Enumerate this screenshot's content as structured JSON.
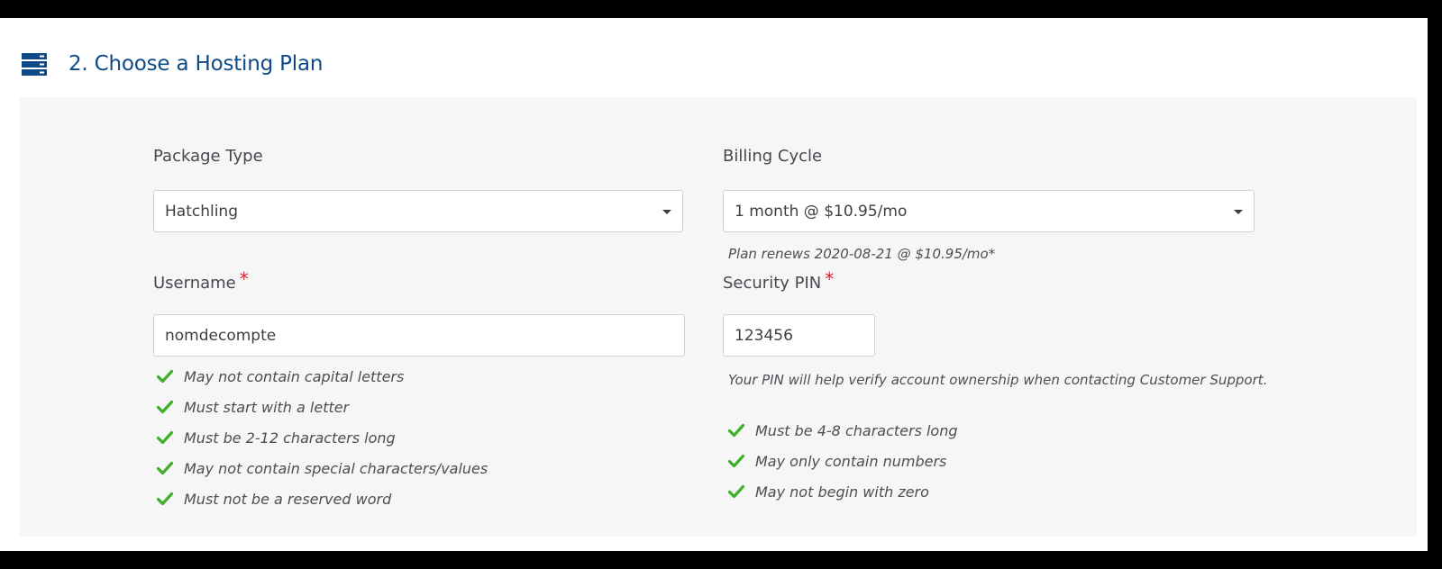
{
  "header": {
    "title": "2. Choose a Hosting Plan",
    "icon": "server-stack-icon",
    "accent_color": "#0e4a86"
  },
  "package_type": {
    "label": "Package Type",
    "selected": "Hatchling"
  },
  "billing_cycle": {
    "label": "Billing Cycle",
    "selected": "1 month @ $10.95/mo",
    "renewal_note": "Plan renews 2020-08-21 @ $10.95/mo*"
  },
  "username": {
    "label": "Username",
    "required_mark": "*",
    "value": "nomdecompte",
    "rules": [
      "May not contain capital letters",
      "Must start with a letter",
      "Must be 2-12 characters long",
      "May not contain special characters/values",
      "Must not be a reserved word"
    ]
  },
  "security_pin": {
    "label": "Security PIN",
    "required_mark": "*",
    "value": "123456",
    "help": "Your PIN will help verify account ownership when contacting Customer Support.",
    "rules": [
      "Must be 4-8 characters long",
      "May only contain numbers",
      "May not begin with zero"
    ]
  },
  "colors": {
    "check": "#3fae29",
    "required": "#d9232e"
  }
}
